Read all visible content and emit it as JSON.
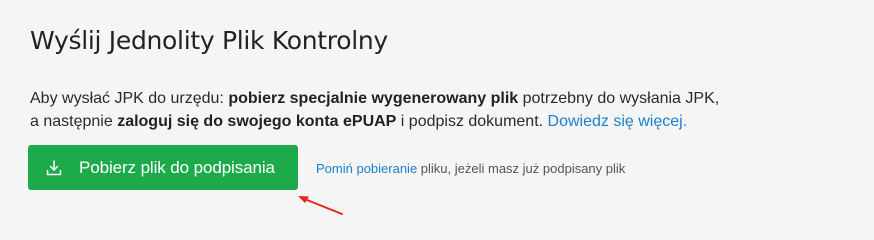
{
  "page": {
    "title": "Wyślij Jednolity Plik Kontrolny"
  },
  "description": {
    "part1": "Aby wysłać JPK do urzędu: ",
    "bold1": "pobierz specjalnie wygenerowany plik",
    "part2": " potrzebny do wysłania JPK,",
    "part3": "a następnie ",
    "bold2": "zaloguj się do swojego konta ePUAP",
    "part4": " i podpisz dokument. ",
    "link": "Dowiedz się więcej."
  },
  "download_button": {
    "label": "Pobierz plik do podpisania",
    "icon": "download-icon"
  },
  "skip": {
    "link": "Pomiń pobieranie",
    "text": " pliku, jeżeli masz już podpisany plik"
  },
  "annotation": {
    "arrow_color": "#e5261f"
  },
  "colors": {
    "button_bg": "#1caa4a",
    "link": "#1a7fd1"
  }
}
